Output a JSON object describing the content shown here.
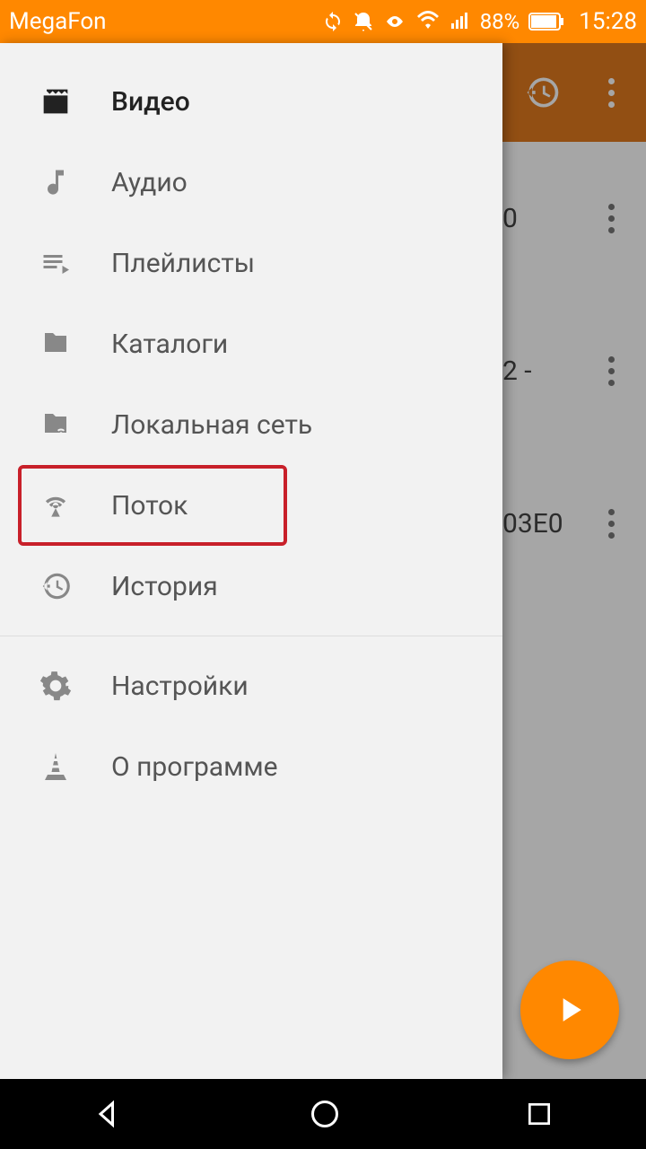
{
  "status": {
    "carrier": "MegaFon",
    "battery_pct": "88%",
    "time": "15:28"
  },
  "drawer": {
    "items": [
      {
        "label": "Видео"
      },
      {
        "label": "Аудио"
      },
      {
        "label": "Плейлисты"
      },
      {
        "label": "Каталоги"
      },
      {
        "label": "Локальная сеть"
      },
      {
        "label": "Поток"
      },
      {
        "label": "История"
      },
      {
        "label": "Настройки"
      },
      {
        "label": "О программе"
      }
    ]
  },
  "content": {
    "rows": [
      {
        "text": "0"
      },
      {
        "text": "2 -"
      },
      {
        "text": "03E0"
      }
    ]
  }
}
